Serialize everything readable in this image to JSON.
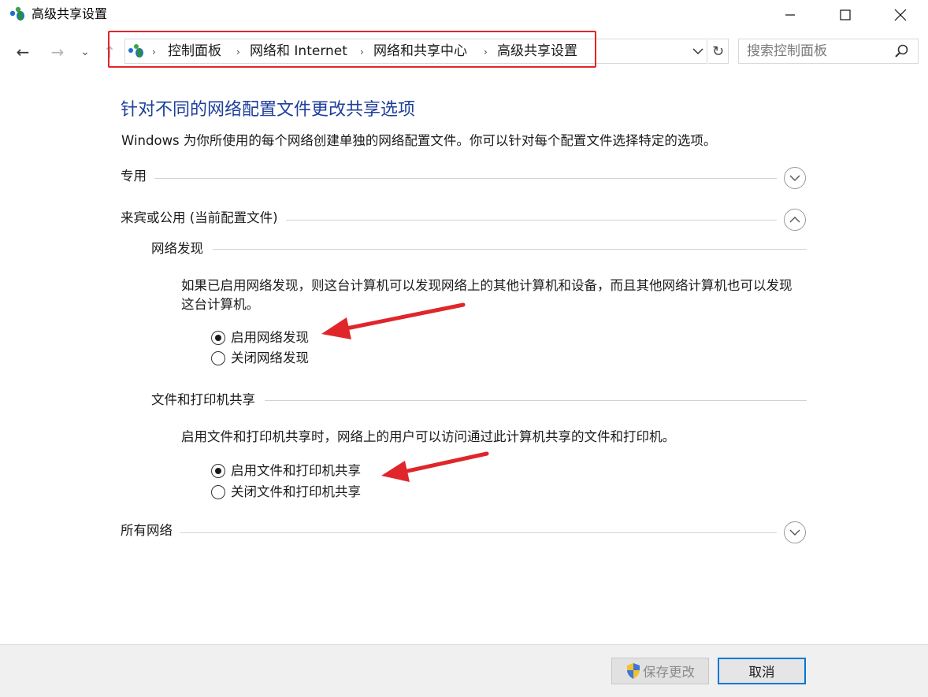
{
  "window": {
    "title": "高级共享设置",
    "controls": [
      "minimize-icon",
      "maximize-icon",
      "close-icon"
    ]
  },
  "nav": {
    "back": "←",
    "forward": "→",
    "recent": "⌄",
    "up": "↑",
    "refresh": "↻"
  },
  "address": {
    "breadcrumbs": [
      "控制面板",
      "网络和 Internet",
      "网络和共享中心",
      "高级共享设置"
    ],
    "separator": "›"
  },
  "search": {
    "placeholder": "搜索控制面板"
  },
  "content": {
    "heading": "针对不同的网络配置文件更改共享选项",
    "description": "Windows 为你所使用的每个网络创建单独的网络配置文件。你可以针对每个配置文件选择特定的选项。",
    "profiles": {
      "private": {
        "label": "专用",
        "expanded": false
      },
      "guest_public": {
        "label": "来宾或公用 (当前配置文件)",
        "expanded": true
      },
      "all": {
        "label": "所有网络",
        "expanded": false
      }
    },
    "network_discovery": {
      "label": "网络发现",
      "description": "如果已启用网络发现，则这台计算机可以发现网络上的其他计算机和设备，而且其他网络计算机也可以发现这台计算机。",
      "options": [
        "启用网络发现",
        "关闭网络发现"
      ],
      "selected": 0
    },
    "file_printer_sharing": {
      "label": "文件和打印机共享",
      "description": "启用文件和打印机共享时，网络上的用户可以访问通过此计算机共享的文件和打印机。",
      "options": [
        "启用文件和打印机共享",
        "关闭文件和打印机共享"
      ],
      "selected": 0
    }
  },
  "footer": {
    "save_label": "保存更改",
    "cancel_label": "取消"
  },
  "colors": {
    "heading": "#1e3f9b",
    "annotation": "#e0262b",
    "focus_border": "#0078d7"
  }
}
